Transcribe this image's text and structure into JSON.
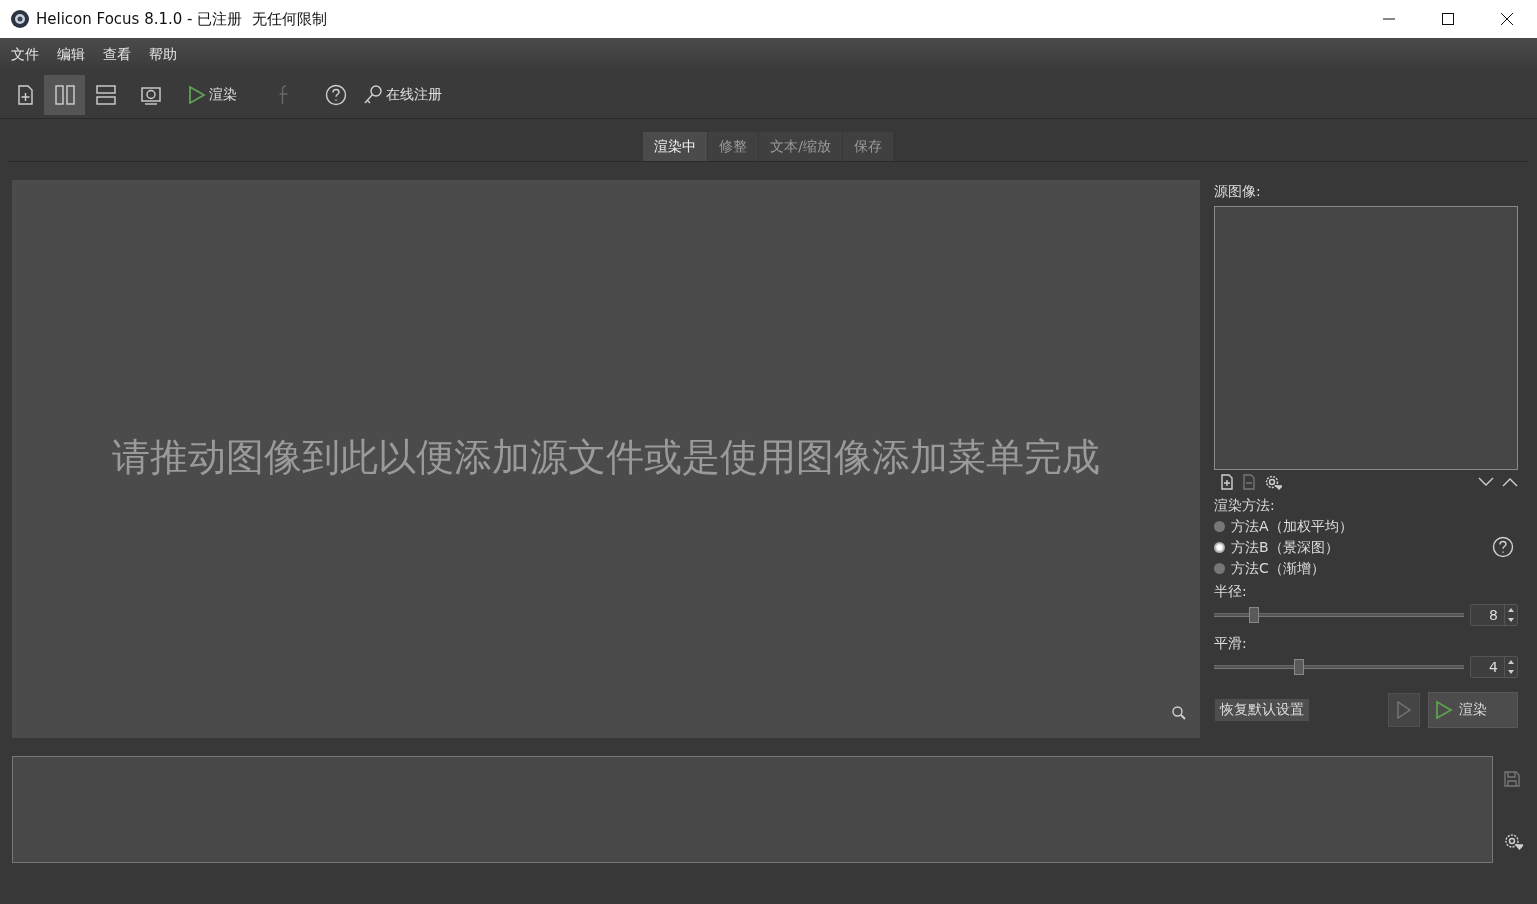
{
  "window": {
    "title": "Helicon Focus 8.1.0 - 已注册  无任何限制"
  },
  "menu": [
    "文件",
    "编辑",
    "查看",
    "帮助"
  ],
  "toolbar": {
    "view_buttons": [
      {
        "selected": true
      },
      {
        "selected": false
      }
    ],
    "render_label": "渲染",
    "facebook": {
      "disabled": true
    },
    "register_label": "在线注册"
  },
  "tabs": [
    {
      "label": "渲染中",
      "selected": true
    },
    {
      "label": "修整",
      "selected": false
    },
    {
      "label": "文本/缩放",
      "selected": false
    },
    {
      "label": "保存",
      "selected": false
    }
  ],
  "preview": {
    "placeholder": "请推动图像到此以便添加源文件或是使用图像添加菜单完成"
  },
  "side_panel": {
    "source_label": "源图像:",
    "method_label": "渲染方法:",
    "methods": [
      {
        "label": "方法A（加权平均）",
        "selected": false
      },
      {
        "label": "方法B（景深图）",
        "selected": true
      },
      {
        "label": "方法C（渐增）",
        "selected": false
      }
    ],
    "sliders": [
      {
        "label": "半径:",
        "level": 0.16,
        "value": "8"
      },
      {
        "label": "平滑:",
        "level": 0.34,
        "value": "4"
      }
    ],
    "reset_button": "恢复默认设置",
    "render_button": "渲染"
  }
}
